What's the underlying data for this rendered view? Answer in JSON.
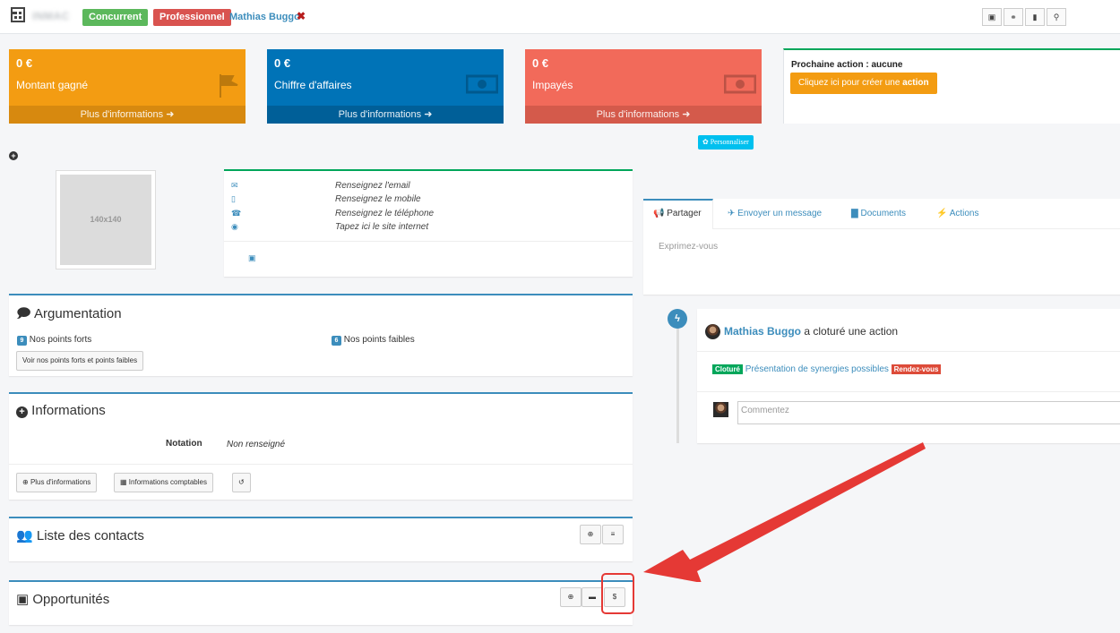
{
  "topbar": {
    "company": "INMAC",
    "badge_competitor": "Concurrent",
    "badge_professional": "Professionnel",
    "contact_name": "Mathias Buggo",
    "remove_icon": "✖",
    "tools": [
      "pdf-icon",
      "link-icon",
      "trash-icon",
      "map-pin-icon"
    ]
  },
  "kpis": [
    {
      "value": "0 €",
      "label": "Montant gagné",
      "more": "Plus d'informations",
      "icon": "flag-icon",
      "color": "#f39c12"
    },
    {
      "value": "0 €",
      "label": "Chiffre d'affaires",
      "more": "Plus d'informations",
      "icon": "money-icon",
      "color": "#0073b7"
    },
    {
      "value": "0 €",
      "label": "Impayés",
      "more": "Plus d'informations",
      "icon": "money-icon",
      "color": "#f26a5a"
    }
  ],
  "next_action": {
    "title": "Prochaine action : aucune",
    "button_prefix": "Cliquez ici pour créer une ",
    "button_bold": "action"
  },
  "personnaliser": "Personnaliser",
  "avatar_placeholder": "140x140",
  "contact_lines": [
    "Renseignez l'email",
    "Renseignez le mobile",
    "Renseignez le téléphone",
    "Tapez ici le site internet"
  ],
  "argumentation": {
    "title": "Argumentation",
    "strong_count": "9",
    "strong_label": "Nos points forts",
    "weak_count": "6",
    "weak_label": "Nos points faibles",
    "button": "Voir nos points forts et points faibles"
  },
  "informations": {
    "title": "Informations",
    "notation_label": "Notation",
    "notation_value": "Non renseigné",
    "btn_more": "Plus d'informations",
    "btn_accounting": "Informations comptables"
  },
  "contacts": {
    "title": "Liste des contacts"
  },
  "opportunities": {
    "title": "Opportunités"
  },
  "tabs": [
    "Partager",
    "Envoyer un message",
    "Documents",
    "Actions"
  ],
  "share_placeholder": "Exprimez-vous",
  "timeline": {
    "user": "Mathias Buggo",
    "action_text": "a cloturé une action",
    "status": "Cloturé",
    "link": "Présentation de synergies possibles",
    "type": "Rendez-vous",
    "comment_placeholder": "Commentez"
  },
  "colors": {
    "primary": "#3c8dbc",
    "success": "#00a65a",
    "warning": "#f39c12",
    "danger": "#d9534f",
    "info": "#00c0ef",
    "annotation": "#e53935"
  }
}
